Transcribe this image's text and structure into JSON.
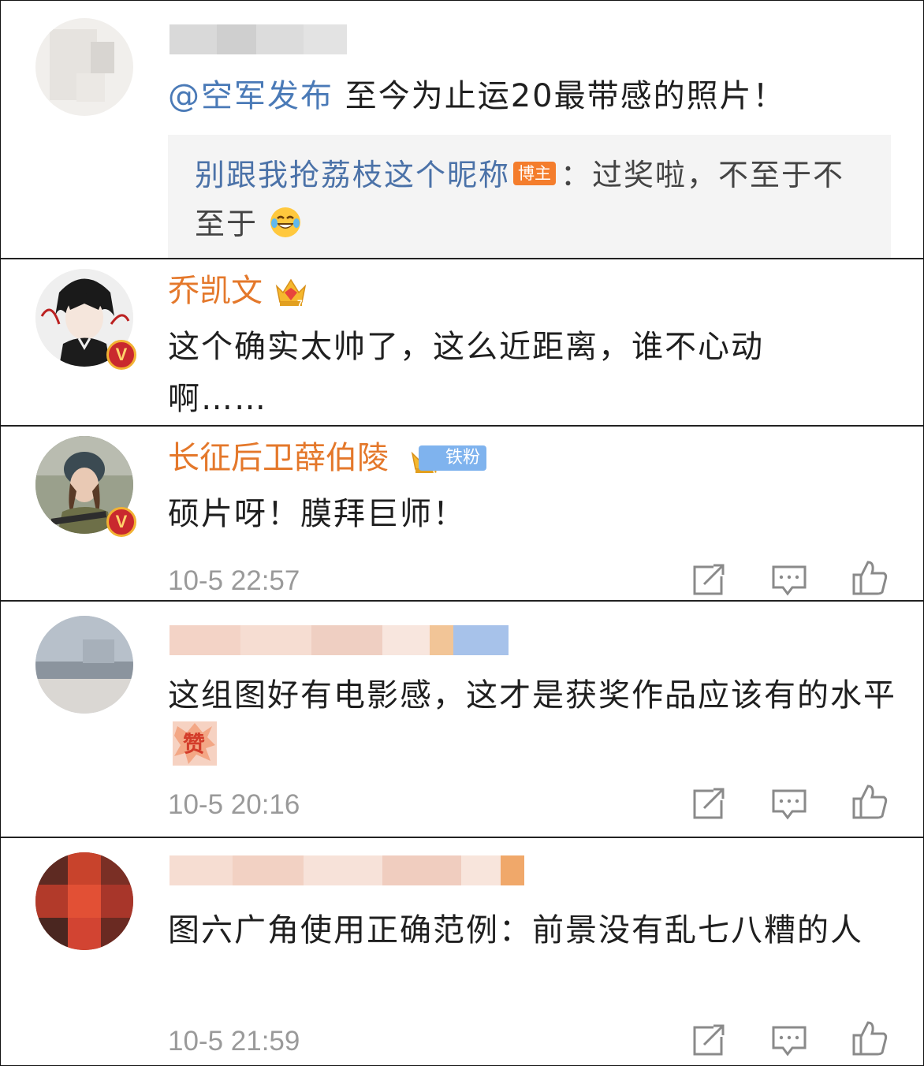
{
  "comments": [
    {
      "mention": "@空军发布",
      "text": " 至今为止运20最带感的照片！",
      "reply": {
        "user": "别跟我抢荔枝这个昵称",
        "badge": "博主",
        "text": "：过奖啦，不至于不至于"
      }
    },
    {
      "username": "乔凯文",
      "text": "这个确实太帅了，这么近距离，谁不心动啊……",
      "crown_level": "7"
    },
    {
      "username": "长征后卫薛伯陵",
      "fan_badge": "铁粉",
      "crown_level": "6",
      "text": "硕片呀！膜拜巨师！",
      "time": "10-5 22:57"
    },
    {
      "text": "这组图好有电影感，这才是获奖作品应该有的水平",
      "time": "10-5 20:16"
    },
    {
      "text": "图六广角使用正确范例：前景没有乱七八糟的人",
      "time": "10-5 21:59"
    }
  ],
  "verified_mark": "V",
  "colors": {
    "username": "#e4782b",
    "mention": "#4a7ab7",
    "reply_user": "#4b72a8",
    "timestamp": "#9a9a9a",
    "verified_badge": "#c9292e"
  },
  "icons": [
    "repost-icon",
    "comment-icon",
    "like-icon",
    "laugh-cry-emoji",
    "zan-sticker",
    "crown-icon"
  ]
}
